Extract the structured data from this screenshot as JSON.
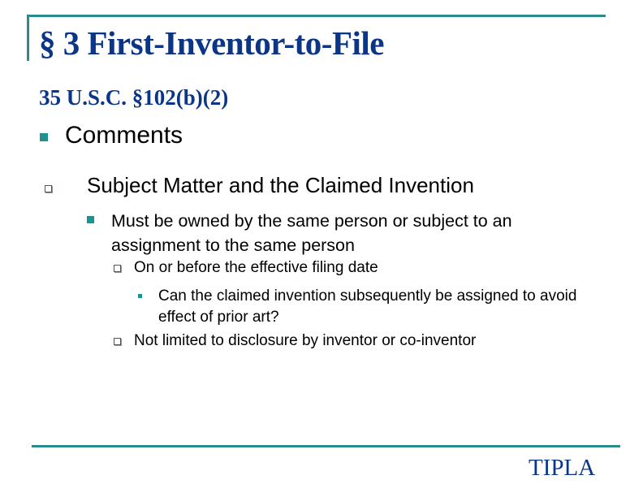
{
  "slide": {
    "title": "§ 3 First-Inventor-to-File",
    "subtitle": "35 U.S.C. §102(b)(2)",
    "bullets": [
      {
        "level": 1,
        "icon": "filled-square-bullet",
        "text": "Comments"
      },
      {
        "level": 2,
        "icon": "hollow-square-bullet",
        "text": "Subject Matter and the Claimed Invention"
      },
      {
        "level": 3,
        "icon": "filled-square-bullet",
        "text": "Must be owned by the same person or subject to an assignment to the same person"
      },
      {
        "level": 4,
        "icon": "hollow-square-bullet",
        "text": "On or before the effective filing date"
      },
      {
        "level": 5,
        "icon": "small-filled-square-bullet",
        "text": "Can the claimed invention subsequently be assigned to avoid effect of prior art?"
      },
      {
        "level": 4,
        "icon": "hollow-square-bullet",
        "text": "Not limited to disclosure by inventor or co-inventor"
      }
    ],
    "footer": "TIPLA"
  },
  "colors": {
    "accent": "#2a8c8c",
    "title": "#0b3587",
    "bullet": "#21918f"
  }
}
